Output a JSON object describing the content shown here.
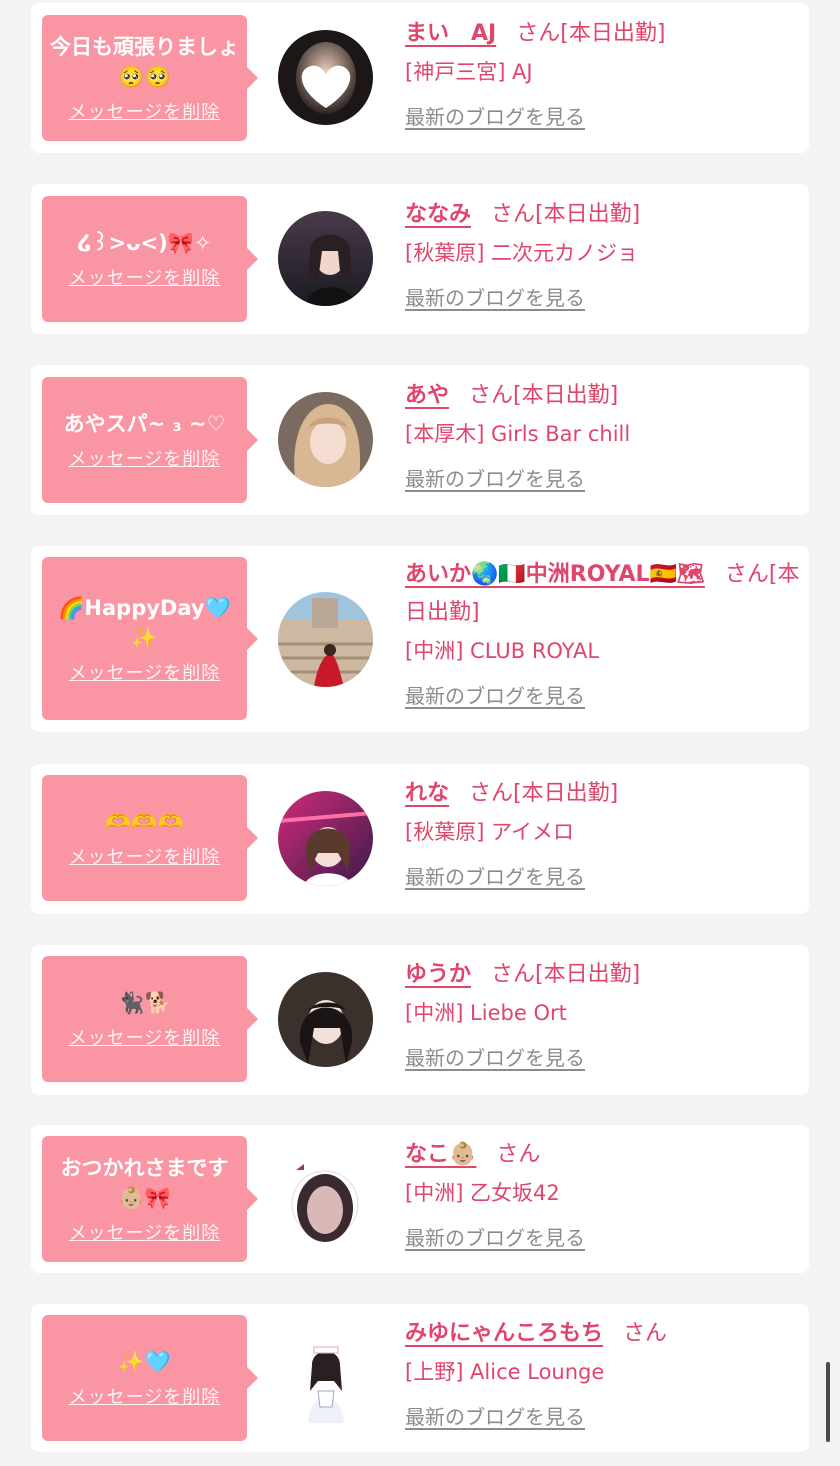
{
  "delete_label": "メッセージを削除",
  "san_label": "さん",
  "blog_label": "最新のブログを見る",
  "colors": {
    "bubble": "#fa95a4",
    "accent": "#e0456b",
    "link_gray": "#8c8c8c",
    "background": "#f3f3f3"
  },
  "messages": [
    {
      "message": "今日も頑張りましょ🥺🥺",
      "name": "まい　AJ",
      "name_emoji": "",
      "work": "[本日出勤]",
      "shop": "[神戸三宮] AJ"
    },
    {
      "message": "໒꒱>ᴗ<)🎀✧",
      "name": "ななみ",
      "name_emoji": "",
      "work": "[本日出勤]",
      "shop": "[秋葉原] 二次元カノジョ"
    },
    {
      "message": "あやスパ~ ₃ ~♡",
      "name": "あや",
      "name_emoji": "",
      "work": "[本日出勤]",
      "shop": "[本厚木] Girls Bar chill"
    },
    {
      "message": "🌈HappyDay🩵✨",
      "name": "あいか🌏🇮🇹中洲ROYAL🇪🇸🗺",
      "name_emoji": "",
      "work": "[本日出勤]",
      "shop": "[中洲] CLUB ROYAL"
    },
    {
      "message": "🫶🫶🫶",
      "name": "れな",
      "name_emoji": "",
      "work": "[本日出勤]",
      "shop": "[秋葉原] アイメロ"
    },
    {
      "message": "🐈‍⬛🐕",
      "name": "ゆうか",
      "name_emoji": "",
      "work": "[本日出勤]",
      "shop": "[中洲] Liebe Ort"
    },
    {
      "message": "おつかれさまです👶🏼🎀",
      "name": "なこ👶🏼",
      "name_emoji": "",
      "work": "",
      "shop": "[中洲] 乙女坂42"
    },
    {
      "message": "✨🩵",
      "name": "みゆにゃんころもち",
      "name_emoji": "",
      "work": "",
      "shop": "[上野] Alice Lounge"
    }
  ]
}
